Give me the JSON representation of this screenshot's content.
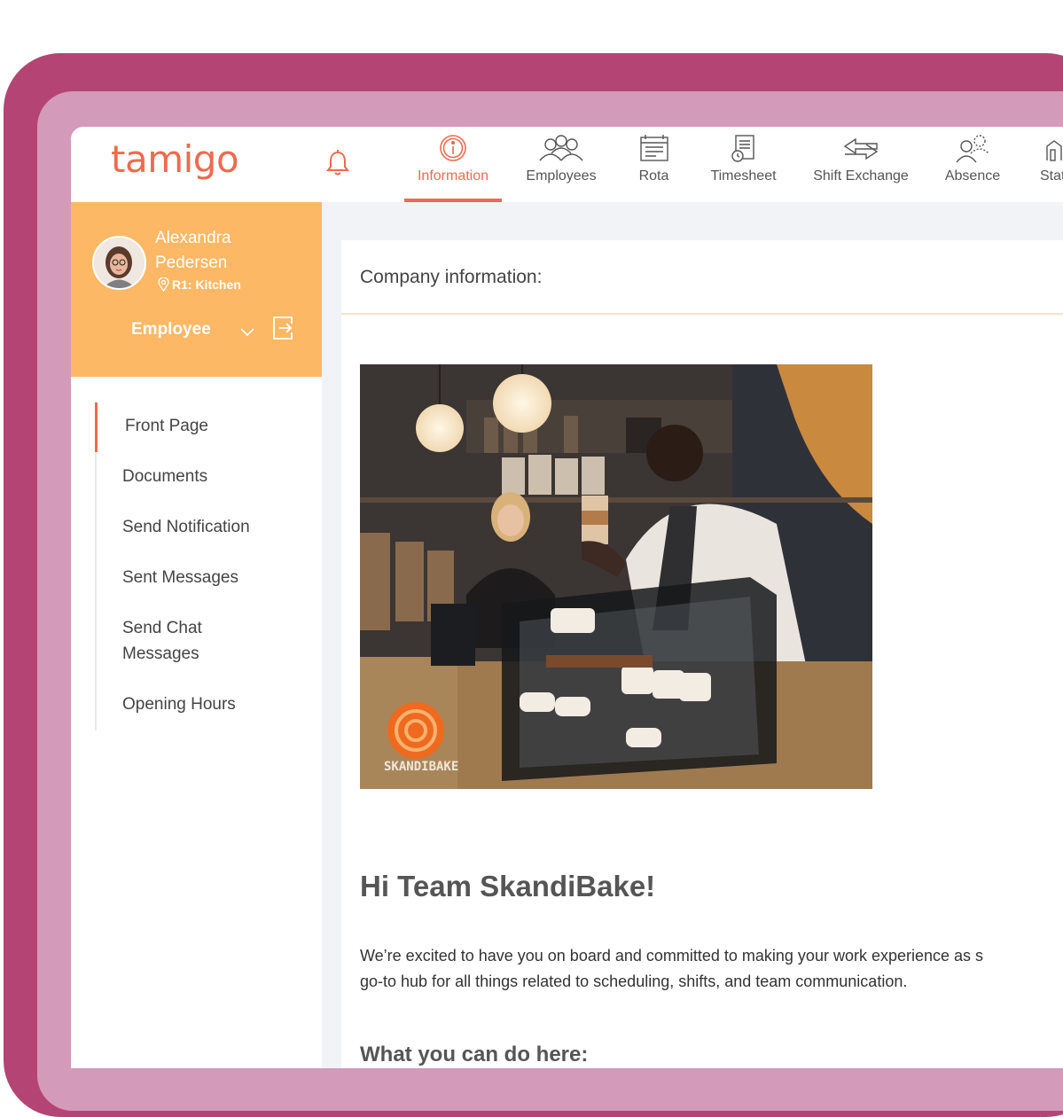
{
  "app": {
    "logo": "tamigo",
    "accent": "#ef6a4e",
    "sidebar_color": "#fdb865"
  },
  "nav": [
    {
      "label": "Information",
      "icon": "info-icon",
      "active": true
    },
    {
      "label": "Employees",
      "icon": "employees-icon"
    },
    {
      "label": "Rota",
      "icon": "rota-icon"
    },
    {
      "label": "Timesheet",
      "icon": "timesheet-icon"
    },
    {
      "label": "Shift Exchange",
      "icon": "shift-exchange-icon"
    },
    {
      "label": "Absence",
      "icon": "absence-icon"
    },
    {
      "label": "Stati",
      "icon": "statistics-icon"
    }
  ],
  "user": {
    "name": "Alexandra Pedersen",
    "location": "R1: Kitchen",
    "role": "Employee"
  },
  "menu": [
    {
      "label": "Front Page",
      "active": true
    },
    {
      "label": "Documents"
    },
    {
      "label": "Send Notification"
    },
    {
      "label": "Sent Messages"
    },
    {
      "label": "Send Chat Messages"
    },
    {
      "label": "Opening Hours"
    }
  ],
  "content": {
    "title": "Company information:",
    "photo_brand": "SKANDIBAKE",
    "heading": "Hi Team SkandiBake!",
    "para_line1": "We’re excited to have you on board and committed to making your work experience as s",
    "para_line2": "go-to hub for all things related to scheduling, shifts, and team communication.",
    "subheading": "What you can do here:"
  }
}
